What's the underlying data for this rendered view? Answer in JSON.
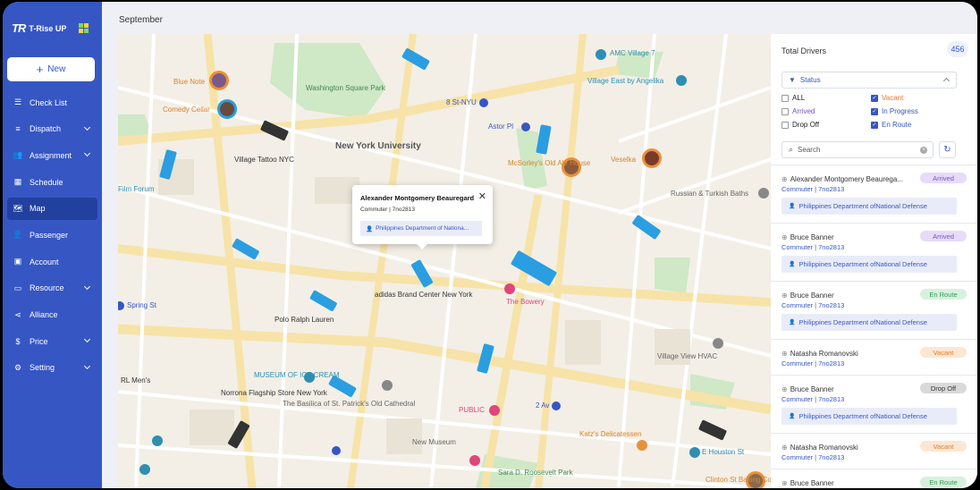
{
  "app": {
    "brand_mark": "TR",
    "brand_name": "T-Rise UP"
  },
  "new_button": {
    "label": "New",
    "icon": "plus-icon"
  },
  "sidebar": {
    "items": [
      {
        "label": "Check List",
        "icon": "checklist-icon",
        "chevron": false
      },
      {
        "label": "Dispatch",
        "icon": "list-icon",
        "chevron": true
      },
      {
        "label": "Assignment",
        "icon": "users-icon",
        "chevron": true
      },
      {
        "label": "Schedule",
        "icon": "calendar-icon",
        "chevron": false
      },
      {
        "label": "Map",
        "icon": "map-icon",
        "chevron": false,
        "active": true
      },
      {
        "label": "Passenger",
        "icon": "passenger-icon",
        "chevron": false
      },
      {
        "label": "Account",
        "icon": "account-icon",
        "chevron": false
      },
      {
        "label": "Resource",
        "icon": "folder-icon",
        "chevron": true
      },
      {
        "label": "Alliance",
        "icon": "share-icon",
        "chevron": false
      },
      {
        "label": "Price",
        "icon": "dollar-icon",
        "chevron": true
      },
      {
        "label": "Setting",
        "icon": "gear-icon",
        "chevron": true
      }
    ]
  },
  "header": {
    "title": "September"
  },
  "panel": {
    "title": "Total Drivers",
    "count": "456",
    "status_label": "Status",
    "filters": [
      {
        "label": "ALL",
        "checked": false,
        "color": "#222222"
      },
      {
        "label": "Vacant",
        "checked": true,
        "color": "#e07c2c"
      },
      {
        "label": "Arrived",
        "checked": false,
        "color": "#7b4fcf"
      },
      {
        "label": "In Progress",
        "checked": true,
        "color": "#3656c4"
      },
      {
        "label": "Drop Off",
        "checked": false,
        "color": "#222222"
      },
      {
        "label": "En Route",
        "checked": true,
        "color": "#3656c4"
      }
    ],
    "search_placeholder": "Search",
    "drivers": [
      {
        "name": "Alexander Montgomery Beaurega...",
        "sub": "Commuter | 7no2813",
        "status": "Arrived",
        "kind": "arrived",
        "org": "Philippines Department ofNational Defense"
      },
      {
        "name": "Bruce Banner",
        "sub": "Commuter | 7no2813",
        "status": "Arrived",
        "kind": "arrived",
        "org": "Philippines Department ofNational Defense"
      },
      {
        "name": "Bruce Banner",
        "sub": "Commuter | 7no2813",
        "status": "En Route",
        "kind": "enroute",
        "org": "Philippines Department ofNational Defense"
      },
      {
        "name": "Natasha Romanovski",
        "sub": "Commuter | 7no2813",
        "status": "Vacant",
        "kind": "vacant",
        "org": ""
      },
      {
        "name": "Bruce Banner",
        "sub": "Commuter | 7no2813",
        "status": "Drop Off",
        "kind": "dropoff",
        "org": "Philippines Department ofNational Defense"
      },
      {
        "name": "Natasha Romanovski",
        "sub": "Commuter | 7no2813",
        "status": "Vacant",
        "kind": "vacant",
        "org": ""
      },
      {
        "name": "Bruce Banner",
        "sub": "",
        "status": "En Route",
        "kind": "enroute",
        "org": ""
      }
    ]
  },
  "popup": {
    "name": "Alexander Montgomery Beauregard",
    "sub": "Commuter | 7no2813",
    "org": "Philippines Department of Nationa..."
  },
  "map": {
    "labels": [
      {
        "text": "Washington Square Park",
        "color": "#3b8a4f"
      },
      {
        "text": "New York University",
        "color": "#555555"
      },
      {
        "text": "Blue Note",
        "color": "#d9822b"
      },
      {
        "text": "Comedy Cellar",
        "color": "#d9822b"
      },
      {
        "text": "Village Tattoo NYC",
        "color": "#333333"
      },
      {
        "text": "8 St-NYU",
        "color": "#3656c4"
      },
      {
        "text": "Astor Pl",
        "color": "#3656c4"
      },
      {
        "text": "AMC Village 7",
        "color": "#2e8fb3"
      },
      {
        "text": "Village East by Angelika",
        "color": "#2e8fb3"
      },
      {
        "text": "McSorley's Old Ale House",
        "color": "#d9822b"
      },
      {
        "text": "Veselka",
        "color": "#d9822b"
      },
      {
        "text": "Russian & Turkish Baths",
        "color": "#666666"
      },
      {
        "text": "Film Forum",
        "color": "#2e8fb3"
      },
      {
        "text": "adidas Brand Center New York",
        "color": "#333333"
      },
      {
        "text": "Polo Ralph Lauren",
        "color": "#333333"
      },
      {
        "text": "Spring St",
        "color": "#3656c4"
      },
      {
        "text": "The Bowery",
        "color": "#e0457b"
      },
      {
        "text": "Village View HVAC",
        "color": "#666666"
      },
      {
        "text": "MUSEUM OF ICE CREAM",
        "color": "#2e8fb3"
      },
      {
        "text": "Norrona Flagship Store New York",
        "color": "#333333"
      },
      {
        "text": "The Basilica of St. Patrick's Old Cathedral",
        "color": "#666666"
      },
      {
        "text": "PUBLIC",
        "color": "#e0457b"
      },
      {
        "text": "2 Av",
        "color": "#3656c4"
      },
      {
        "text": "Katz's Delicatessen",
        "color": "#d9822b"
      },
      {
        "text": "E Houston St",
        "color": "#2e8fb3"
      },
      {
        "text": "New Museum",
        "color": "#666666"
      },
      {
        "text": "Clinton St Baking Company",
        "color": "#d9822b"
      },
      {
        "text": "Sara D. Roosevelt Park",
        "color": "#3b8a4f"
      },
      {
        "text": "RL Men's",
        "color": "#333333"
      }
    ]
  },
  "colors": {
    "brand": "#3656c4",
    "sidebar_active": "#22409e",
    "map_bg": "#f3efe6",
    "park": "#cfe8c6"
  }
}
